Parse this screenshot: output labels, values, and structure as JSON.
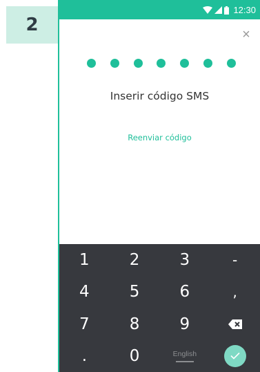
{
  "step": {
    "number": "2"
  },
  "status_bar": {
    "time": "12:30"
  },
  "dialog": {
    "title": "Inserir código SMS",
    "resend_label": "Reenviar código",
    "code_length": 7,
    "close_label": "×"
  },
  "keypad": {
    "row1": [
      "1",
      "2",
      "3",
      "-"
    ],
    "row2": [
      "4",
      "5",
      "6",
      ","
    ],
    "row3": [
      "7",
      "8",
      "9"
    ],
    "row4": [
      ".",
      "0"
    ],
    "language": "English"
  },
  "colors": {
    "accent": "#1fbf9a",
    "badge": "#cdeee4",
    "keyboard": "#37393e"
  },
  "icons": {
    "wifi": "wifi-icon",
    "signal": "cell-signal-icon",
    "battery": "battery-icon",
    "close": "close-icon",
    "backspace": "backspace-icon",
    "done": "check-icon"
  }
}
